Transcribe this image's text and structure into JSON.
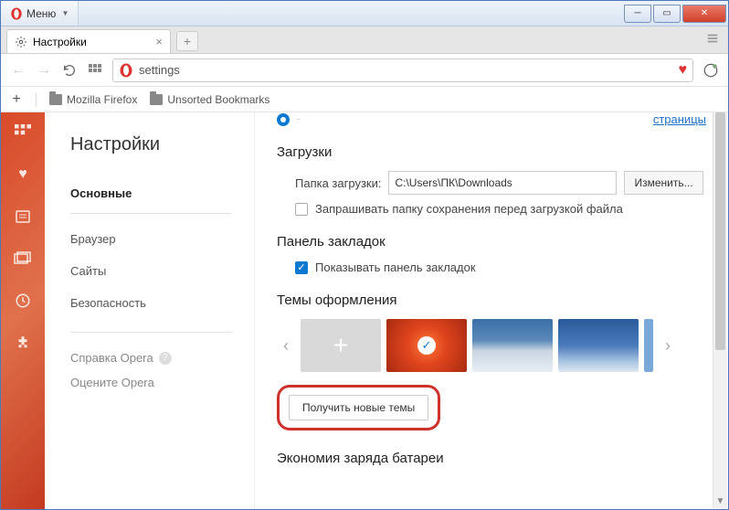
{
  "window": {
    "menu_label": "Меню"
  },
  "tab": {
    "title": "Настройки"
  },
  "address_bar": {
    "value": "settings"
  },
  "bookmarks_bar": {
    "items": [
      "Mozilla Firefox",
      "Unsorted Bookmarks"
    ]
  },
  "settings": {
    "title": "Настройки",
    "nav": {
      "basic": "Основные",
      "browser": "Браузер",
      "sites": "Сайты",
      "security": "Безопасность",
      "help": "Справка Opera",
      "rate": "Оцените Opera"
    },
    "startup": {
      "link_text": "страницы"
    },
    "downloads": {
      "heading": "Загрузки",
      "folder_label": "Папка загрузки:",
      "folder_value": "C:\\Users\\ПК\\Downloads",
      "change_btn": "Изменить...",
      "ask_checkbox": "Запрашивать папку сохранения перед загрузкой файла"
    },
    "bookmarks_panel": {
      "heading": "Панель закладок",
      "show_checkbox": "Показывать панель закладок"
    },
    "themes": {
      "heading": "Темы оформления",
      "get_more_btn": "Получить новые темы"
    },
    "battery": {
      "heading": "Экономия заряда батареи"
    }
  }
}
